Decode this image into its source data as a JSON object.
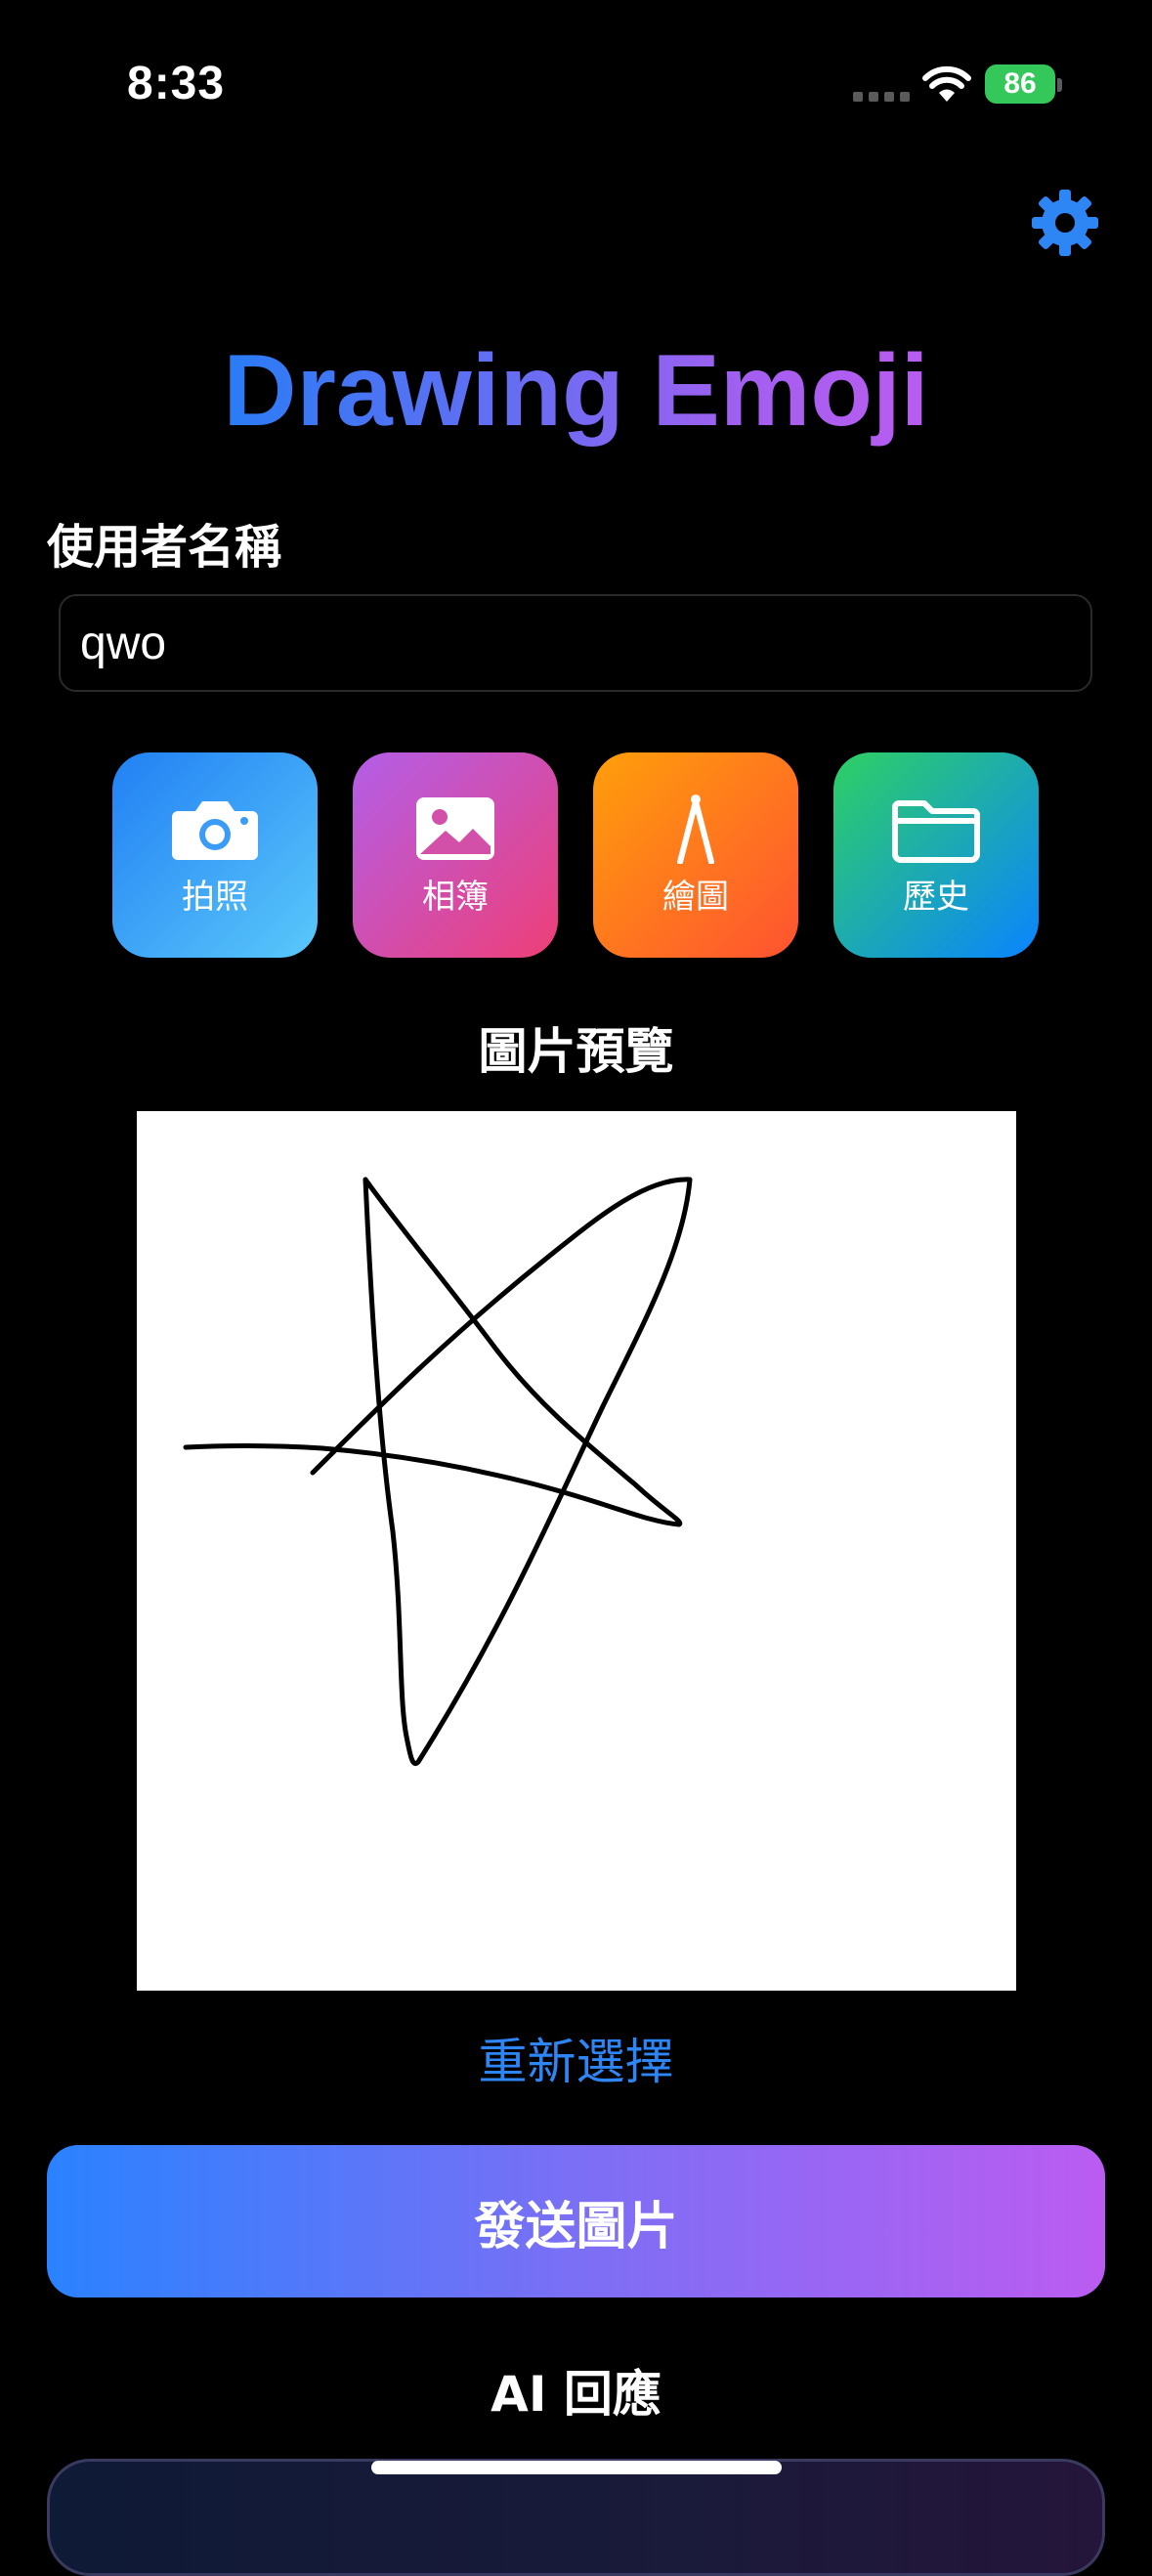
{
  "status_bar": {
    "time": "8:33",
    "battery": "86"
  },
  "header": {
    "title": "Drawing Emoji",
    "settings_icon": "gear-icon",
    "accent": "#2e86f5"
  },
  "form": {
    "username_label": "使用者名稱",
    "username_value": "qwo"
  },
  "actions": [
    {
      "label": "拍照",
      "icon": "camera-icon"
    },
    {
      "label": "相簿",
      "icon": "photo-icon"
    },
    {
      "label": "繪圖",
      "icon": "compass-icon"
    },
    {
      "label": "歷史",
      "icon": "folder-icon"
    }
  ],
  "preview": {
    "heading": "圖片預覽",
    "reselect_label": "重新選擇"
  },
  "send": {
    "label": "發送圖片"
  },
  "ai": {
    "heading": "AI 回應"
  }
}
